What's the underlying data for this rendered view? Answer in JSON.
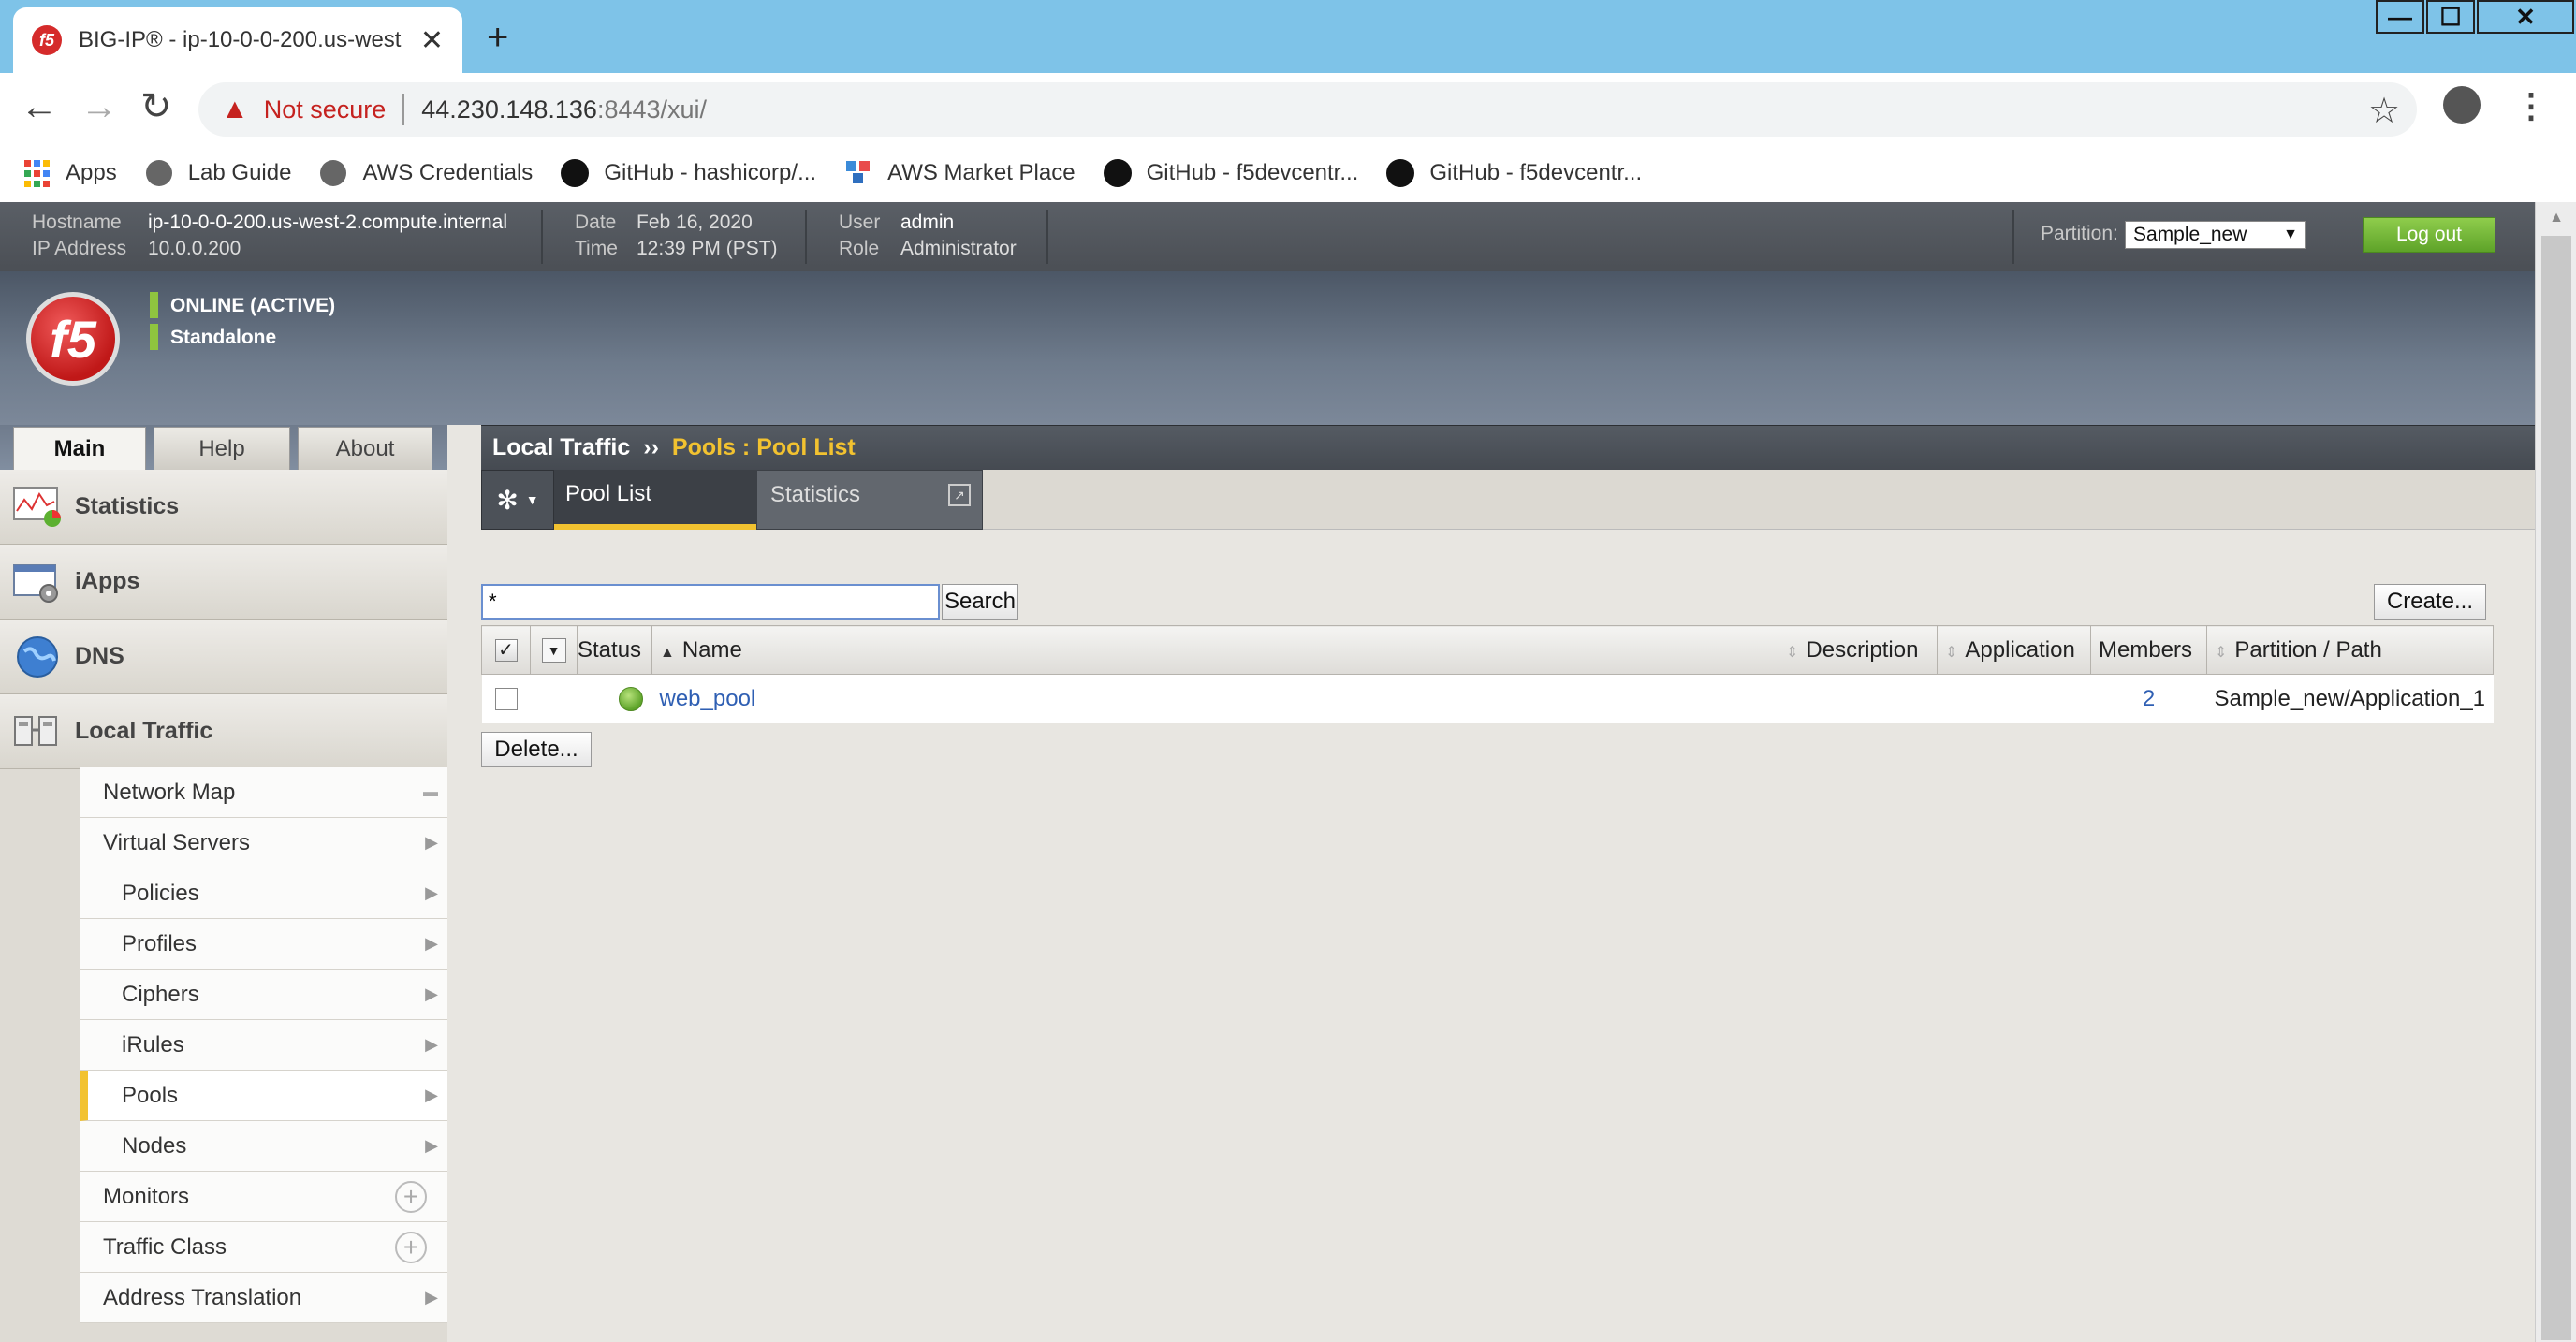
{
  "browser": {
    "tab_title": "BIG-IP® - ip-10-0-0-200.us-west",
    "favicon_text": "f5",
    "close": "✕",
    "new_tab": "+",
    "not_secure": "Not secure",
    "url_host": "44.230.148.136",
    "url_rest": ":8443/xui/",
    "window_controls": [
      "—",
      "☐",
      "✕"
    ],
    "bookmarks": [
      {
        "label": "Apps",
        "icon": "apps-grid-icon"
      },
      {
        "label": "Lab Guide",
        "icon": "globe-icon"
      },
      {
        "label": "AWS Credentials",
        "icon": "globe-icon"
      },
      {
        "label": "GitHub - hashicorp/...",
        "icon": "github-icon"
      },
      {
        "label": "AWS Market Place",
        "icon": "aws-cubes-icon"
      },
      {
        "label": "GitHub - f5devcentr...",
        "icon": "github-icon"
      },
      {
        "label": "GitHub - f5devcentr...",
        "icon": "github-icon"
      }
    ]
  },
  "header": {
    "hostname_label": "Hostname",
    "hostname": "ip-10-0-0-200.us-west-2.compute.internal",
    "ip_label": "IP Address",
    "ip": "10.0.0.200",
    "date_label": "Date",
    "date": "Feb 16, 2020",
    "time_label": "Time",
    "time": "12:39 PM (PST)",
    "user_label": "User",
    "user": "admin",
    "role_label": "Role",
    "role": "Administrator",
    "partition_label": "Partition:",
    "partition": "Sample_new",
    "logout": "Log out"
  },
  "banner": {
    "logo_text": "f5",
    "status1": "ONLINE (ACTIVE)",
    "status2": "Standalone",
    "status_color": "#8fc43f"
  },
  "nav": {
    "tabs": [
      "Main",
      "Help",
      "About"
    ],
    "sections": [
      {
        "label": "Statistics",
        "icon": "statistics-chart-icon"
      },
      {
        "label": "iApps",
        "icon": "iapps-window-icon"
      },
      {
        "label": "DNS",
        "icon": "dns-globe-icon"
      },
      {
        "label": "Local Traffic",
        "icon": "local-traffic-icon"
      }
    ],
    "submenu": [
      {
        "label": "Network Map"
      },
      {
        "label": "Virtual Servers"
      },
      {
        "label": "Policies"
      },
      {
        "label": "Profiles"
      },
      {
        "label": "Ciphers"
      },
      {
        "label": "iRules"
      },
      {
        "label": "Pools"
      },
      {
        "label": "Nodes"
      },
      {
        "label": "Monitors"
      },
      {
        "label": "Traffic Class"
      },
      {
        "label": "Address Translation"
      }
    ]
  },
  "breadcrumb": {
    "root": "Local Traffic",
    "sep": "››",
    "current": "Pools : Pool List"
  },
  "subtabs": {
    "pool_list": "Pool List",
    "statistics": "Statistics"
  },
  "search": {
    "value": "*",
    "button": "Search"
  },
  "create_button": "Create...",
  "delete_button": "Delete...",
  "table": {
    "headers": {
      "status": "Status",
      "name": "Name",
      "description": "Description",
      "application": "Application",
      "members": "Members",
      "partition": "Partition / Path"
    },
    "rows": [
      {
        "name": "web_pool",
        "description": "",
        "application": "",
        "members": "2",
        "partition": "Sample_new/Application_1",
        "status_color": "#5ea42a"
      }
    ]
  },
  "colors": {
    "accent_yellow": "#f2c230",
    "link_blue": "#2f5fb3",
    "logout_green": "#6fb531"
  }
}
